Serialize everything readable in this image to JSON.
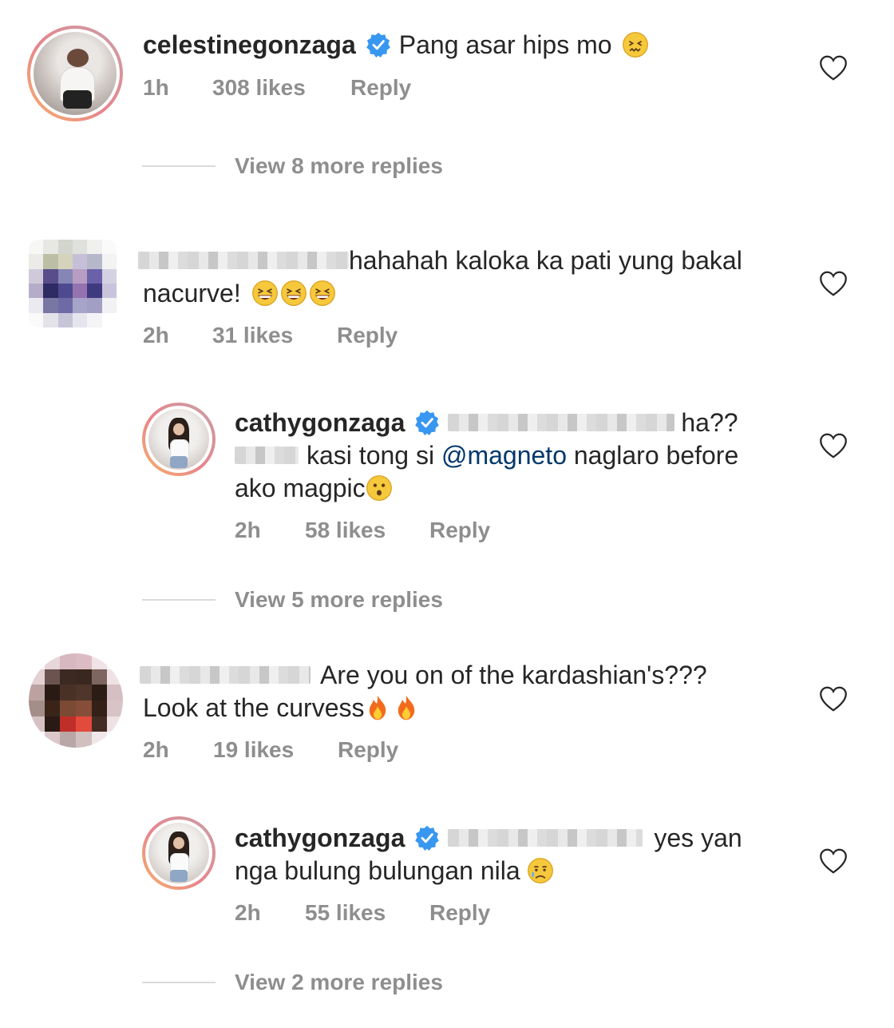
{
  "comments": [
    {
      "username": "celestinegonzaga",
      "verified": true,
      "text": "Pang asar hips mo",
      "emoji": "confounded-face",
      "time": "1h",
      "likes": "308 likes",
      "reply": "Reply"
    },
    {
      "username_hidden": true,
      "text_line1": "hahahah kaloka ka pati yung bakal",
      "text_line2": "nacurve!",
      "emoji": "grinning-squinting-face-x3",
      "time": "2h",
      "likes": "31 likes",
      "reply": "Reply"
    },
    {
      "username": "cathygonzaga",
      "verified": true,
      "text_line1_end": "ha??",
      "text_line2_before": "kasi tong si",
      "mention": "@magneto",
      "text_line2_after": "naglaro before",
      "text_line3": "ako magpic",
      "emoji": "hushed-face",
      "time": "2h",
      "likes": "58 likes",
      "reply": "Reply"
    },
    {
      "username_hidden": true,
      "text_line1": "Are you on of the kardashian's???",
      "text_line2": "Look at the curvess",
      "emoji": "fire-x2",
      "time": "2h",
      "likes": "19 likes",
      "reply": "Reply"
    },
    {
      "username": "cathygonzaga",
      "verified": true,
      "text_line1_end": "yes yan",
      "text_line2": "nga bulung bulungan nila",
      "emoji": "sad-but-relieved-face",
      "time": "2h",
      "likes": "55 likes",
      "reply": "Reply"
    }
  ],
  "view_more": [
    "View 8 more replies",
    "View 5 more replies",
    "View 2 more replies"
  ],
  "colors": {
    "verified": "#3897f0",
    "meta": "#8e8e8e",
    "mention": "#00376b"
  }
}
